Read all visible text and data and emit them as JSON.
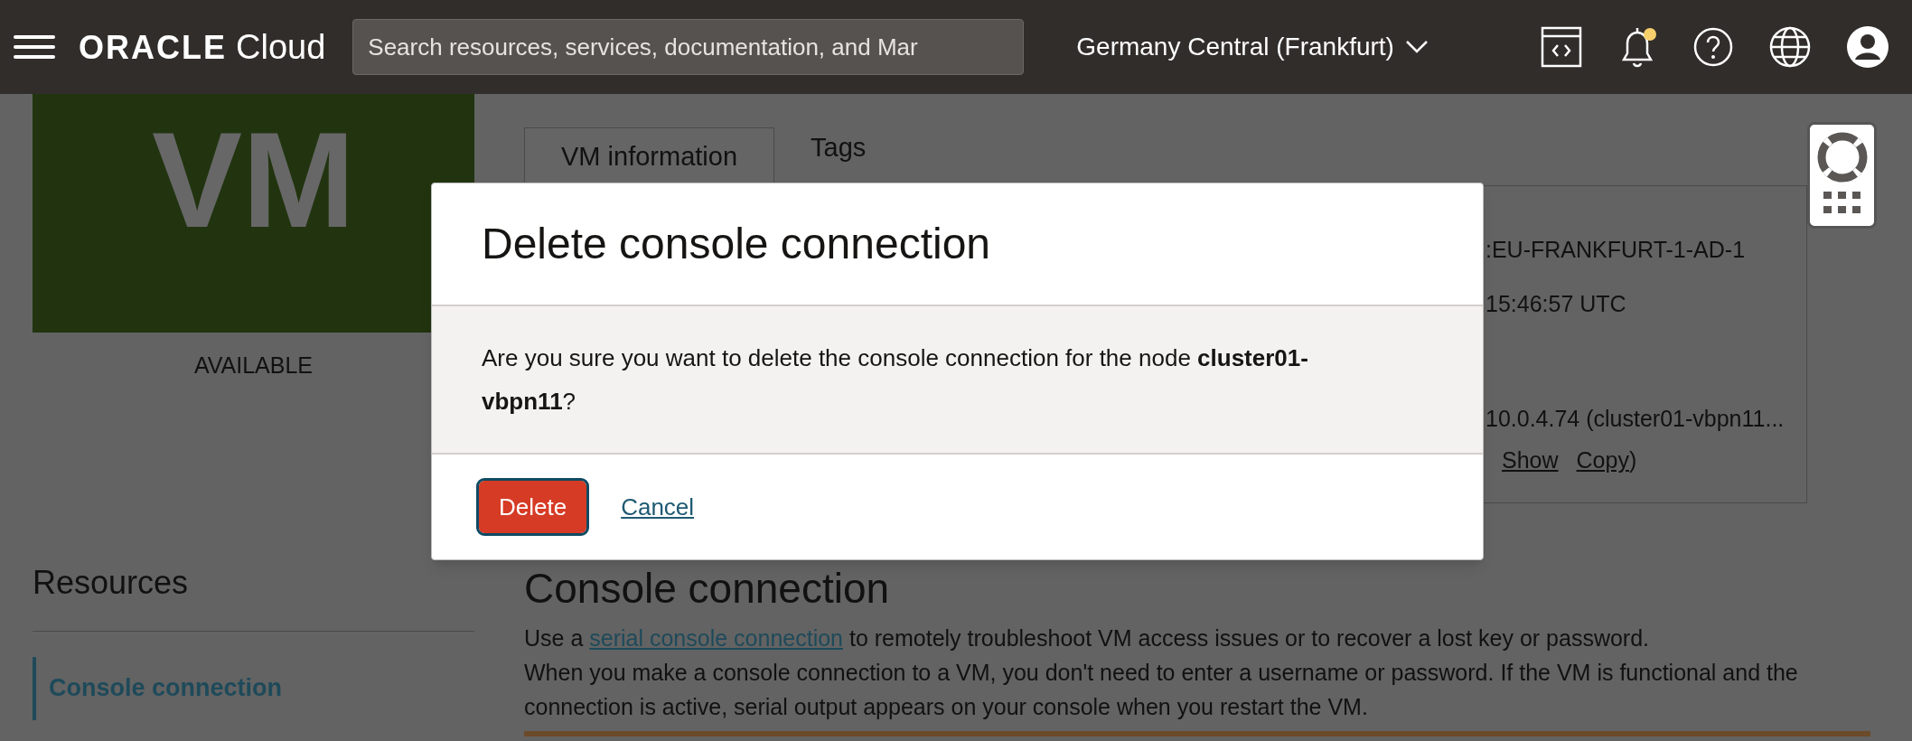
{
  "top_bar": {
    "logo": {
      "brand": "ORACLE",
      "product": "Cloud"
    },
    "search": {
      "placeholder": "Search resources, services, documentation, and Mar"
    },
    "region": "Germany Central (Frankfurt)",
    "notifications_unread": true
  },
  "instance": {
    "tile_text": "VM",
    "status": "AVAILABLE"
  },
  "resources": {
    "title": "Resources",
    "items": [
      {
        "label": "Console connection",
        "selected": true
      }
    ]
  },
  "tabs": [
    {
      "label": "VM information",
      "selected": true
    },
    {
      "label": "Tags",
      "selected": false
    }
  ],
  "info_panel": {
    "lines": [
      ":EU-FRANKFURT-1-AD-1",
      "15:46:57 UTC",
      "10.0.4.74 (cluster01-vbpn11..."
    ],
    "links": [
      "Show",
      "Copy"
    ],
    "closing": ")"
  },
  "section": {
    "title": "Console connection",
    "intro": {
      "before": "Use a ",
      "link": "serial console connection",
      "after": " to remotely troubleshoot VM access issues or to recover a lost key or password."
    },
    "paragraph": "When you make a console connection to a VM, you don't need to enter a username or password. If the VM is functional and the connection is active, serial output appears on your console when you restart the VM."
  },
  "dialog": {
    "title": "Delete console connection",
    "message": "Are you sure you want to delete the console connection for the node **cluster01-vbpn11**?",
    "buttons": [
      {
        "label": "Delete",
        "kind": "danger",
        "focused": true
      },
      {
        "label": "Cancel",
        "kind": "link",
        "focused": false
      }
    ]
  }
}
